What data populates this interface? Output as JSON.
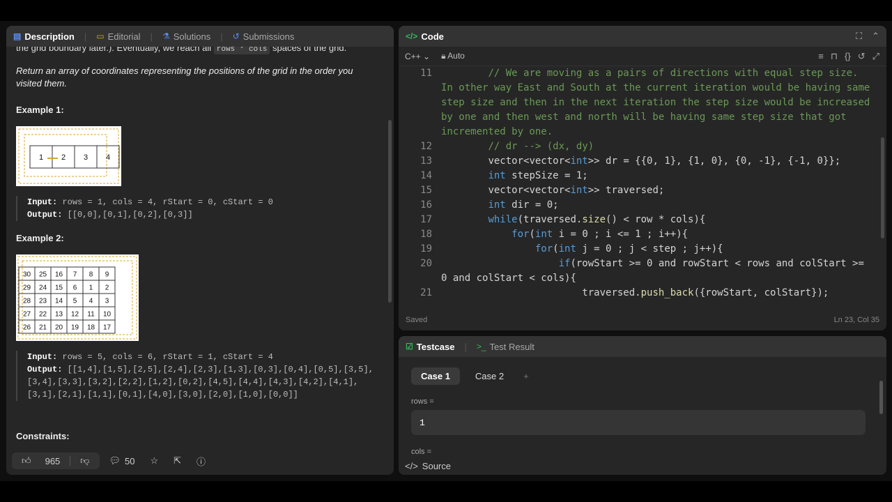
{
  "left_tabs": [
    {
      "label": "Description",
      "icon": "document-icon"
    },
    {
      "label": "Editorial",
      "icon": "book-icon"
    },
    {
      "label": "Solutions",
      "icon": "flask-icon"
    },
    {
      "label": "Submissions",
      "icon": "history-icon"
    }
  ],
  "description": {
    "cut_line_pre": "the grid boundary later.). Eventually, we reach all ",
    "cut_line_code": "rows * cols",
    "cut_line_post": " spaces of the grid.",
    "return_text": "Return an array of coordinates representing the positions of the grid in the order you visited them.",
    "example1_title": "Example 1:",
    "example1_grid": [
      "1",
      "2",
      "3",
      "4"
    ],
    "example1_input_label": "Input:",
    "example1_input": "rows = 1, cols = 4, rStart = 0, cStart = 0",
    "example1_output_label": "Output:",
    "example1_output": "[[0,0],[0,1],[0,2],[0,3]]",
    "example2_title": "Example 2:",
    "example2_grid": [
      [
        "30",
        "25",
        "16",
        "7",
        "8",
        "9"
      ],
      [
        "29",
        "24",
        "15",
        "6",
        "1",
        "2"
      ],
      [
        "28",
        "23",
        "14",
        "5",
        "4",
        "3"
      ],
      [
        "27",
        "22",
        "13",
        "12",
        "11",
        "10"
      ],
      [
        "26",
        "21",
        "20",
        "19",
        "18",
        "17"
      ]
    ],
    "example2_input_label": "Input:",
    "example2_input": "rows = 5, cols = 6, rStart = 1, cStart = 4",
    "example2_output_label": "Output:",
    "example2_output": "[[1,4],[1,5],[2,5],[2,4],[2,3],[1,3],[0,3],[0,4],[0,5],[3,5],[3,4],[3,3],[3,2],[2,2],[1,2],[0,2],[4,5],[4,4],[4,3],[4,2],[4,1],[3,1],[2,1],[1,1],[0,1],[4,0],[3,0],[2,0],[1,0],[0,0]]",
    "constraints_title": "Constraints:"
  },
  "footer": {
    "likes": "965",
    "comments": "50"
  },
  "code_panel": {
    "title": "Code",
    "language": "C++",
    "mode": "Auto",
    "status_left": "Saved",
    "status_right": "Ln 23, Col 35"
  },
  "code_lines": [
    {
      "n": "11",
      "html": "        <span class=\"cm\">// We are moving as a pairs of directions with equal step size. In other way East and South at the current iteration would be having same step size and then in the next iteration the step size would be increased by one and then west and north will be having same step size that got incremented by one.</span>"
    },
    {
      "n": "12",
      "html": "        <span class=\"cm\">// dr --&gt; (dx, dy)</span>"
    },
    {
      "n": "13",
      "html": "        vector&lt;vector&lt;<span class=\"kw\">int</span>&gt;&gt; dr = {{0, 1}, {1, 0}, {0, -1}, {-1, 0}};"
    },
    {
      "n": "14",
      "html": "        <span class=\"kw\">int</span> stepSize = 1;"
    },
    {
      "n": "15",
      "html": "        vector&lt;vector&lt;<span class=\"kw\">int</span>&gt;&gt; traversed;"
    },
    {
      "n": "16",
      "html": "        <span class=\"kw\">int</span> dir = 0;"
    },
    {
      "n": "17",
      "html": "        <span class=\"kw\">while</span>(traversed.<span class=\"fn\">size</span>() &lt; row * cols){"
    },
    {
      "n": "18",
      "html": "            <span class=\"kw\">for</span>(<span class=\"kw\">int</span> i = 0 ; i &lt;= 1 ; i++){"
    },
    {
      "n": "19",
      "html": "                <span class=\"kw\">for</span>(<span class=\"kw\">int</span> j = 0 ; j &lt; step ; j++){"
    },
    {
      "n": "20",
      "html": "                    <span class=\"kw\">if</span>(rowStart &gt;= 0 and rowStart &lt; rows and colStart &gt;= 0 and colStart &lt; cols){"
    },
    {
      "n": "21",
      "html": "                        traversed.<span class=\"fn\">push_back</span>({rowStart, colStart});"
    }
  ],
  "test_panel": {
    "tab_testcase": "Testcase",
    "tab_result": "Test Result",
    "cases": [
      "Case 1",
      "Case 2"
    ],
    "plus": "+",
    "rows_label": "rows =",
    "rows_value": "1",
    "cols_label": "cols =",
    "source_label": "Source"
  }
}
